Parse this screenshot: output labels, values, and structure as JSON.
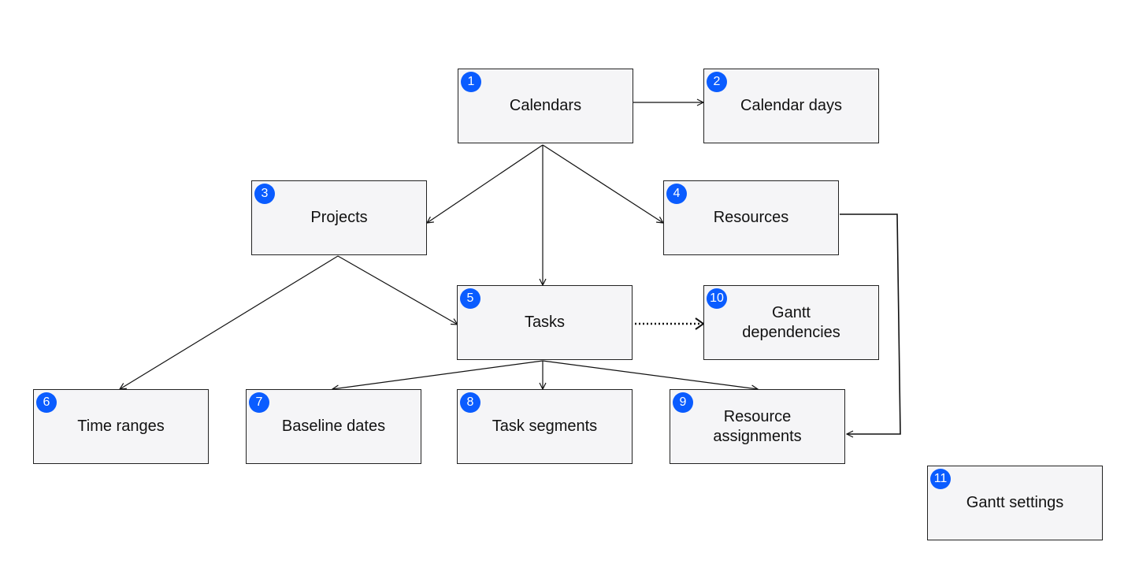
{
  "accent_color": "#0a5cff",
  "nodes": [
    {
      "id": "calendars",
      "number": "1",
      "label": "Calendars"
    },
    {
      "id": "calendar-days",
      "number": "2",
      "label": "Calendar days"
    },
    {
      "id": "projects",
      "number": "3",
      "label": "Projects"
    },
    {
      "id": "resources",
      "number": "4",
      "label": "Resources"
    },
    {
      "id": "tasks",
      "number": "5",
      "label": "Tasks"
    },
    {
      "id": "time-ranges",
      "number": "6",
      "label": "Time ranges"
    },
    {
      "id": "baseline-dates",
      "number": "7",
      "label": "Baseline dates"
    },
    {
      "id": "task-segments",
      "number": "8",
      "label": "Task segments"
    },
    {
      "id": "resource-assignments",
      "number": "9",
      "label": "Resource assignments"
    },
    {
      "id": "gantt-dependencies",
      "number": "10",
      "label": "Gantt dependencies"
    },
    {
      "id": "gantt-settings",
      "number": "11",
      "label": "Gantt settings"
    }
  ],
  "edges": [
    {
      "from": "calendars",
      "to": "calendar-days",
      "style": "solid"
    },
    {
      "from": "calendars",
      "to": "projects",
      "style": "solid"
    },
    {
      "from": "calendars",
      "to": "tasks",
      "style": "solid"
    },
    {
      "from": "calendars",
      "to": "resources",
      "style": "solid"
    },
    {
      "from": "projects",
      "to": "time-ranges",
      "style": "solid"
    },
    {
      "from": "projects",
      "to": "tasks",
      "style": "solid"
    },
    {
      "from": "tasks",
      "to": "gantt-dependencies",
      "style": "dotted"
    },
    {
      "from": "tasks",
      "to": "baseline-dates",
      "style": "solid"
    },
    {
      "from": "tasks",
      "to": "task-segments",
      "style": "solid"
    },
    {
      "from": "tasks",
      "to": "resource-assignments",
      "style": "solid"
    },
    {
      "from": "resources",
      "to": "resource-assignments",
      "style": "elbow"
    }
  ]
}
